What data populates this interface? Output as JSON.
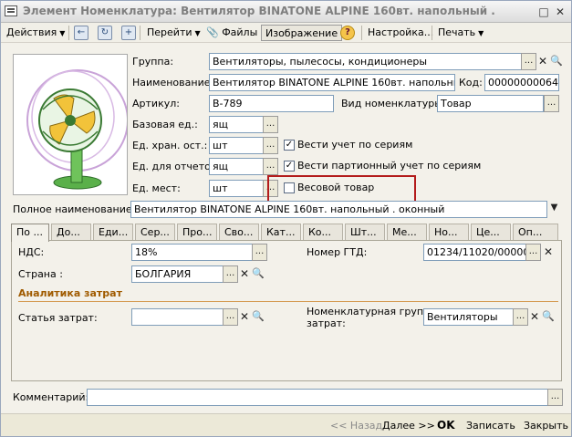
{
  "window": {
    "title": "Элемент Номенклатура: Вентилятор BINATONE ALPINE 160вт. напольный ."
  },
  "toolbar": {
    "actions": "Действия",
    "goto": "Перейти",
    "files": "Файлы",
    "image": "Изображение",
    "settings": "Настройка...",
    "print": "Печать"
  },
  "form": {
    "group_label": "Группа:",
    "group_value": "Вентиляторы, пылесосы, кондиционеры",
    "name_label": "Наименование:",
    "name_value": "Вентилятор BINATONE ALPINE 160вт. напольный .",
    "code_label": "Код:",
    "code_value": "00000000064",
    "article_label": "Артикул:",
    "article_value": "В-789",
    "nomtype_label": "Вид номенклатуры:",
    "nomtype_value": "Товар",
    "baseunit_label": "Базовая ед.:",
    "baseunit_value": "ящ",
    "storeunit_label": "Ед. хран. ост.:",
    "storeunit_value": "шт",
    "reportunit_label": "Ед. для отчетов:",
    "reportunit_value": "ящ",
    "placeunit_label": "Ед. мест:",
    "placeunit_value": "шт",
    "series_label": "Вести учет по сериям",
    "series_checked": true,
    "batch_label": "Вести партионный учет по сериям",
    "batch_checked": true,
    "weight_label": "Весовой товар",
    "weight_checked": false,
    "fullname_label": "Полное наименование:",
    "fullname_value": "Вентилятор BINATONE ALPINE 160вт. напольный . оконный"
  },
  "tabs": [
    "По ...",
    "До...",
    "Еди...",
    "Сер...",
    "Про...",
    "Сво...",
    "Кат...",
    "Ко...",
    "Шт...",
    "Ме...",
    "Но...",
    "Це...",
    "Оп..."
  ],
  "panel": {
    "vat_label": "НДС:",
    "vat_value": "18%",
    "gtd_label": "Номер ГТД:",
    "gtd_value": "01234/11020/0000000",
    "country_label": "Страна :",
    "country_value": "БОЛГАРИЯ",
    "costs_group": "Аналитика затрат",
    "costitem_label": "Статья затрат:",
    "costitem_value": "",
    "nomgroup_label1": "Номенклатурная группа",
    "nomgroup_label2": "затрат:",
    "nomgroup_value": "Вентиляторы"
  },
  "comment": {
    "label": "Комментарий:",
    "value": ""
  },
  "statusbar": {
    "back": "<< Назад",
    "next": "Далее >>",
    "ok": "OK",
    "write": "Записать",
    "close": "Закрыть"
  },
  "colors": {
    "highlight_box": "#b31b1b",
    "group_header": "#a05b00"
  },
  "icons": [
    "window-icon",
    "help-icon",
    "files-icon",
    "refresh-icon",
    "go-icon",
    "select-icon",
    "clear-icon",
    "search-icon",
    "dropdown-icon",
    "fan-image"
  ]
}
